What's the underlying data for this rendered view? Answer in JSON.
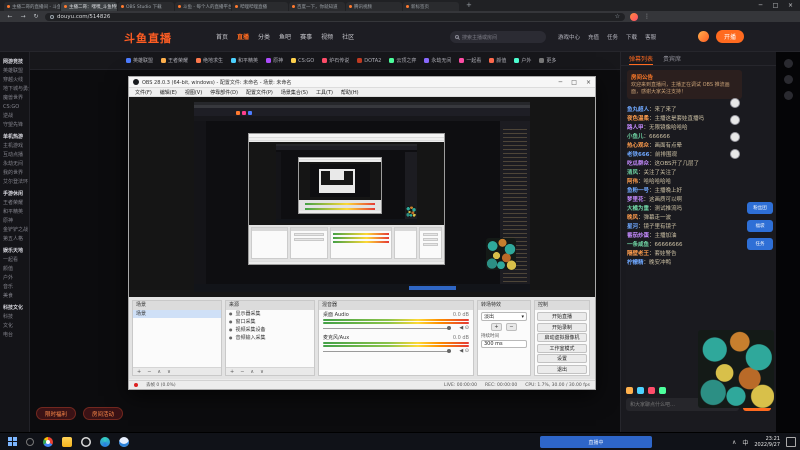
{
  "browser": {
    "tabs": [
      {
        "cls": "",
        "title": "主播二哥的直播间 - 斗鱼"
      },
      {
        "cls": "active",
        "title": "主播二哥：嘿嘿_斗鱼特别版"
      },
      {
        "cls": "",
        "title": "OBS Studio 下载"
      },
      {
        "cls": "",
        "title": "斗鱼 - 每个人的直播平台"
      },
      {
        "cls": "",
        "title": "哔哩哔哩直播"
      },
      {
        "cls": "",
        "title": "百度一下，你就知道"
      },
      {
        "cls": "",
        "title": "腾讯视频"
      },
      {
        "cls": "",
        "title": "新标签页"
      }
    ],
    "new_tab_label": "+",
    "nav_icons": [
      "←",
      "→",
      "↻"
    ],
    "url": "douyu.com/514826",
    "star": "☆",
    "menu": "⋮",
    "controls": [
      "─",
      "□",
      "×"
    ]
  },
  "site": {
    "logo": "斗鱼直播",
    "nav": [
      {
        "cls": "",
        "label": "首页"
      },
      {
        "cls": "active",
        "label": "直播"
      },
      {
        "cls": "",
        "label": "分类"
      },
      {
        "cls": "",
        "label": "鱼吧"
      },
      {
        "cls": "",
        "label": "赛事"
      },
      {
        "cls": "",
        "label": "视频"
      },
      {
        "cls": "",
        "label": "社区"
      }
    ],
    "search_placeholder": "搜索主播或房间",
    "actions": [
      "游戏中心",
      "充值",
      "任务",
      "下载",
      "客服"
    ],
    "go_live": "开播",
    "categories": [
      {
        "label": "英雄联盟",
        "color": "#4d7cff"
      },
      {
        "label": "王者荣耀",
        "color": "#ffb14d"
      },
      {
        "label": "绝地求生",
        "color": "#ff7a4d"
      },
      {
        "label": "和平精英",
        "color": "#4dd2ff"
      },
      {
        "label": "原神",
        "color": "#b04dff"
      },
      {
        "label": "CS:GO",
        "color": "#ffd24d"
      },
      {
        "label": "炉石传说",
        "color": "#ff4d6a"
      },
      {
        "label": "DOTA2",
        "color": "#c23b22"
      },
      {
        "label": "云顶之弈",
        "color": "#4dff9d"
      },
      {
        "label": "永劫无间",
        "color": "#8a6aff"
      },
      {
        "label": "一起看",
        "color": "#ff4da6"
      },
      {
        "label": "颜值",
        "color": "#ff6a4d"
      },
      {
        "label": "户外",
        "color": "#4dffd2"
      },
      {
        "label": "更多",
        "color": "#777777"
      }
    ],
    "sidebar": [
      {
        "cls": "sb-h",
        "label": "网游竞技"
      },
      {
        "cls": "sb-i",
        "label": "英雄联盟"
      },
      {
        "cls": "sb-i",
        "label": "穿越火线"
      },
      {
        "cls": "sb-i",
        "label": "地下城与勇士"
      },
      {
        "cls": "sb-i",
        "label": "魔兽世界"
      },
      {
        "cls": "sb-i",
        "label": "CS:GO"
      },
      {
        "cls": "sb-i",
        "label": "逆战"
      },
      {
        "cls": "sb-i",
        "label": "守望先锋"
      },
      {
        "cls": "sb-h",
        "label": "单机热游"
      },
      {
        "cls": "sb-i",
        "label": "主机游戏"
      },
      {
        "cls": "sb-i",
        "label": "互动点播"
      },
      {
        "cls": "sb-i",
        "label": "永劫无间"
      },
      {
        "cls": "sb-i",
        "label": "我的世界"
      },
      {
        "cls": "sb-i",
        "label": "艾尔登法环"
      },
      {
        "cls": "sb-h",
        "label": "手游休闲"
      },
      {
        "cls": "sb-i",
        "label": "王者荣耀"
      },
      {
        "cls": "sb-i",
        "label": "和平精英"
      },
      {
        "cls": "sb-i",
        "label": "原神"
      },
      {
        "cls": "sb-i",
        "label": "金铲铲之战"
      },
      {
        "cls": "sb-i",
        "label": "第五人格"
      },
      {
        "cls": "sb-h",
        "label": "娱乐天地"
      },
      {
        "cls": "sb-i",
        "label": "一起看"
      },
      {
        "cls": "sb-i",
        "label": "颜值"
      },
      {
        "cls": "sb-i",
        "label": "户外"
      },
      {
        "cls": "sb-i",
        "label": "音乐"
      },
      {
        "cls": "sb-i",
        "label": "美食"
      },
      {
        "cls": "sb-h",
        "label": "科技文化"
      },
      {
        "cls": "sb-i",
        "label": "科技"
      },
      {
        "cls": "sb-i",
        "label": "文化"
      },
      {
        "cls": "sb-i",
        "label": "电台"
      }
    ],
    "promos": [
      "限时福利",
      "房间活动"
    ],
    "chat": {
      "tabs": [
        {
          "cls": "active",
          "label": "弹幕列表"
        },
        {
          "cls": "",
          "label": "贵宾席"
        }
      ],
      "announcement_title": "房间公告",
      "announcement_text": "欢迎来到直播间，主播正在调试 OBS 推流画面，感谢大家关注支持！",
      "messages": [
        {
          "user": "鱼丸超人",
          "text": "：来了来了",
          "color": "#6fa8ff"
        },
        {
          "user": "夜色温柔",
          "text": "：主播这是套娃直播吗",
          "color": "#ff9d4d"
        },
        {
          "user": "路人甲",
          "text": "：无限镜像哈哈哈",
          "color": "#c58bff"
        },
        {
          "user": "小鱼儿",
          "text": "：666666",
          "color": "#6fd3a3"
        },
        {
          "user": "热心观众",
          "text": "：画面有点晕",
          "color": "#ff9d4d"
        },
        {
          "user": "老铁666",
          "text": "：前排围观",
          "color": "#6fa8ff"
        },
        {
          "user": "吃瓜群众",
          "text": "：这OBS开了几层了",
          "color": "#c58bff"
        },
        {
          "user": "清风",
          "text": "：关注了关注了",
          "color": "#6fd3a3"
        },
        {
          "user": "阿伟",
          "text": "：哈哈哈哈哈",
          "color": "#ff9d4d"
        },
        {
          "user": "鱼粉一号",
          "text": "：主播晚上好",
          "color": "#6fa8ff"
        },
        {
          "user": "梦里花",
          "text": "：这画质可以啊",
          "color": "#c58bff"
        },
        {
          "user": "大橘为重",
          "text": "：测试推流吗",
          "color": "#6fd3a3"
        },
        {
          "user": "晚风",
          "text": "：弹幕走一波",
          "color": "#ff9d4d"
        },
        {
          "user": "星河",
          "text": "：镜子里有镜子",
          "color": "#6fa8ff"
        },
        {
          "user": "番茄炒蛋",
          "text": "：主播加油",
          "color": "#c58bff"
        },
        {
          "user": "一条咸鱼",
          "text": "：66666666",
          "color": "#6fd3a3"
        },
        {
          "user": "隔壁老王",
          "text": "：套娃警告",
          "color": "#ff9d4d"
        },
        {
          "user": "柠檬精",
          "text": "：晚安冲鸭",
          "color": "#6fa8ff"
        }
      ],
      "avatars": [
        "",
        "",
        "",
        ""
      ],
      "pills": [
        "粉丝团",
        "福袋",
        "任务"
      ],
      "emote_colors": [
        "#ffb14d",
        "#4dd2ff",
        "#ff4d6a",
        "#4dff9d"
      ],
      "input_placeholder": "和大家聊点什么吧…",
      "send_label": "发送"
    }
  },
  "obs": {
    "title": "OBS 28.0.3 (64-bit, windows) - 配置文件: 未命名 - 场景: 未命名",
    "controls": [
      "─",
      "□",
      "×"
    ],
    "menus": [
      "文件(F)",
      "编辑(E)",
      "视图(V)",
      "停靠部件(D)",
      "配置文件(P)",
      "场景集合(S)",
      "工具(T)",
      "帮助(H)"
    ],
    "docks": {
      "scenes": {
        "title": "场景",
        "items": [
          {
            "cls": "selected",
            "name": "场景"
          }
        ]
      },
      "sources": {
        "title": "来源",
        "eye": "●",
        "items": [
          {
            "name": "显示器采集"
          },
          {
            "name": "窗口采集"
          },
          {
            "name": "视频采集设备"
          },
          {
            "name": "音频输入采集"
          }
        ]
      },
      "mixer": {
        "title": "混音器",
        "speaker": "◀",
        "gear": "⊙",
        "channels": [
          {
            "name": "桌面 Audio",
            "db": "0.0 dB"
          },
          {
            "name": "麦克风/Aux",
            "db": "0.0 dB"
          }
        ]
      },
      "transitions": {
        "title": "转场特效",
        "value": "淡出",
        "caret": "▾",
        "plus": "+",
        "minus": "−",
        "duration_label": "持续时间",
        "duration": "300 ms"
      },
      "controls": {
        "title": "控制",
        "buttons": [
          "开始直播",
          "开始录制",
          "启动虚拟摄像机",
          "工作室模式",
          "设置",
          "退出"
        ]
      }
    },
    "tools": [
      "+",
      "−",
      "∧",
      "∨"
    ],
    "status": {
      "drop": "丢帧 0 (0.0%)",
      "live": "LIVE: 00:00:00",
      "rec": "REC: 00:00:00",
      "cpu": "CPU: 1.7%, 30.00 / 30.00 fps"
    }
  },
  "taskbar": {
    "icons": [
      {
        "cls": "ic-chrome"
      },
      {
        "cls": "ic-folder"
      },
      {
        "cls": "ic-obs"
      },
      {
        "cls": "ic-edge"
      },
      {
        "cls": "ic-qq"
      }
    ],
    "widget_label": "直播中",
    "tray_caret": "∧",
    "lang": "中",
    "time": "23:21",
    "date": "2022/9/27"
  }
}
